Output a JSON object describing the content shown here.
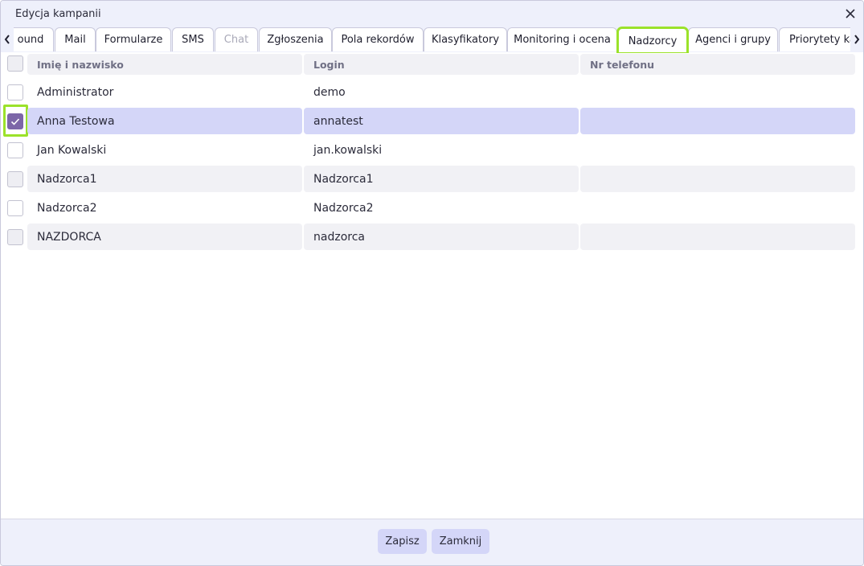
{
  "dialog": {
    "title": "Edycja kampanii",
    "close_icon": "close-icon"
  },
  "tabs": [
    {
      "label": "ound",
      "state": "normal"
    },
    {
      "label": "Mail",
      "state": "normal"
    },
    {
      "label": "Formularze",
      "state": "normal"
    },
    {
      "label": "SMS",
      "state": "normal"
    },
    {
      "label": "Chat",
      "state": "disabled"
    },
    {
      "label": "Zgłoszenia",
      "state": "normal"
    },
    {
      "label": "Pola rekordów",
      "state": "normal"
    },
    {
      "label": "Klasyfikatory",
      "state": "normal"
    },
    {
      "label": "Monitoring i ocena",
      "state": "normal"
    },
    {
      "label": "Nadzorcy",
      "state": "active"
    },
    {
      "label": "Agenci i grupy",
      "state": "normal"
    },
    {
      "label": "Priorytety kampanii",
      "state": "normal"
    }
  ],
  "table": {
    "columns": [
      "Imię i nazwisko",
      "Login",
      "Nr telefonu"
    ],
    "rows": [
      {
        "name": "Administrator",
        "login": "demo",
        "phone": "",
        "checked": false
      },
      {
        "name": "Anna Testowa",
        "login": "annatest",
        "phone": "",
        "checked": true
      },
      {
        "name": "Jan Kowalski",
        "login": "jan.kowalski",
        "phone": "",
        "checked": false
      },
      {
        "name": "Nadzorca1",
        "login": "Nadzorca1",
        "phone": "",
        "checked": false
      },
      {
        "name": "Nadzorca2",
        "login": "Nadzorca2",
        "phone": "",
        "checked": false
      },
      {
        "name": "NAZDORCA",
        "login": "nadzorca",
        "phone": "",
        "checked": false
      }
    ]
  },
  "footer": {
    "save_label": "Zapisz",
    "close_label": "Zamknij"
  },
  "colors": {
    "accent_highlight": "#9be22a",
    "selected_row": "#d4d6f8",
    "checkbox_checked": "#7c66a8",
    "header_bg": "#eef0fb"
  }
}
